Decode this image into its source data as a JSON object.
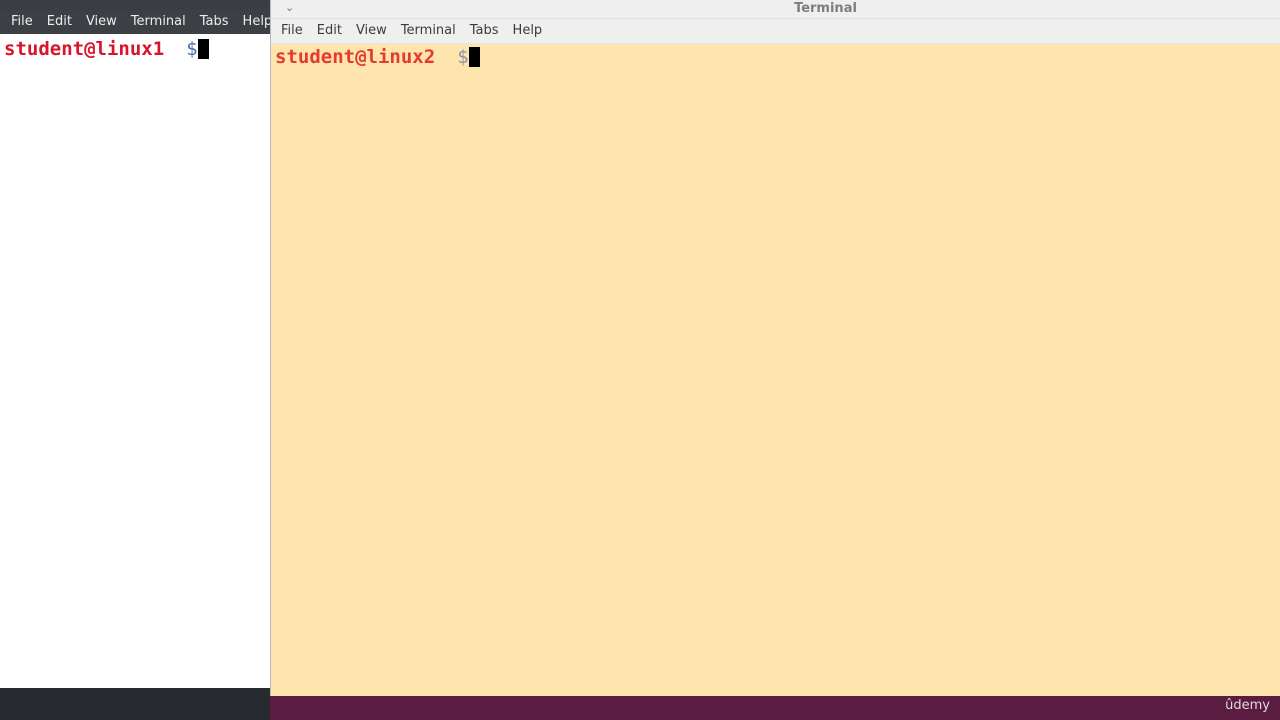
{
  "left_terminal": {
    "menu": [
      "File",
      "Edit",
      "View",
      "Terminal",
      "Tabs",
      "Help"
    ],
    "prompt_user": "student@linux1",
    "prompt_symbol": "$",
    "background": "#ffffff",
    "prompt_color": "#d8152c"
  },
  "right_terminal": {
    "title": "Terminal",
    "collapse_icon": "chevron-down-icon",
    "menu": [
      "File",
      "Edit",
      "View",
      "Terminal",
      "Tabs",
      "Help"
    ],
    "prompt_user": "student@linux2",
    "prompt_symbol": "$",
    "background": "#fde5ad",
    "prompt_color": "#e63a2f"
  },
  "watermark": "ûdemy"
}
